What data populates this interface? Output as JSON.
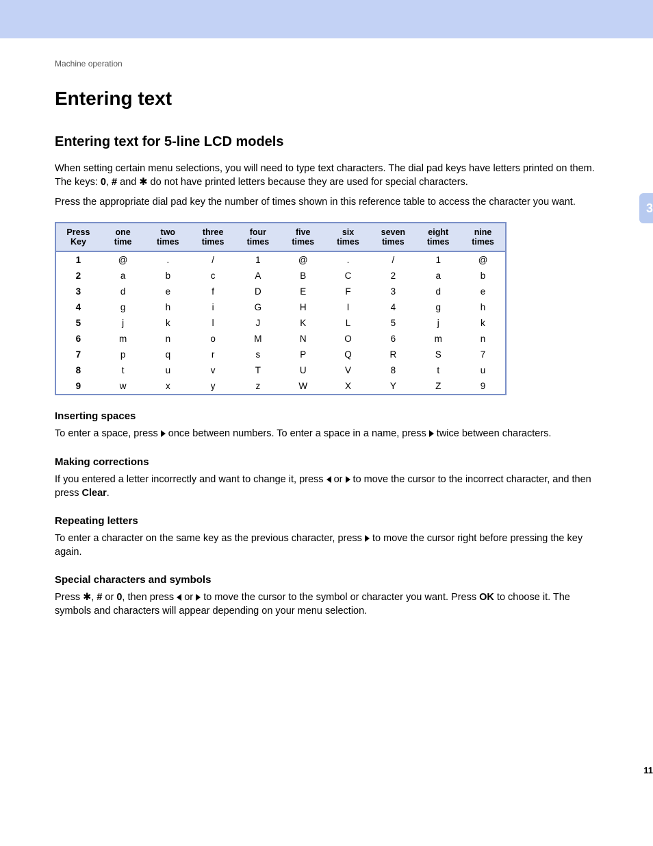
{
  "breadcrumb": "Machine operation",
  "h1": "Entering text",
  "h2": "Entering text for 5-line LCD models",
  "side_tab": "3",
  "page_number": "11",
  "intro": {
    "p1a": "When setting certain menu selections, you will need to type text characters. The dial pad keys have letters printed on them. The keys: ",
    "p1_key0": "0",
    "p1_comma": ", ",
    "p1_hash": "#",
    "p1_and": " and ",
    "p1_star": "✱",
    "p1b": " do not have printed letters because they are used for special characters.",
    "p2": "Press the appropriate dial pad key the number of times shown in this reference table to access the character you want."
  },
  "table": {
    "headers": [
      [
        "Press",
        "Key"
      ],
      [
        "one",
        "time"
      ],
      [
        "two",
        "times"
      ],
      [
        "three",
        "times"
      ],
      [
        "four",
        "times"
      ],
      [
        "five",
        "times"
      ],
      [
        "six",
        "times"
      ],
      [
        "seven",
        "times"
      ],
      [
        "eight",
        "times"
      ],
      [
        "nine",
        "times"
      ]
    ],
    "rows": [
      [
        "1",
        "@",
        ".",
        "/",
        "1",
        "@",
        ".",
        "/",
        "1",
        "@"
      ],
      [
        "2",
        "a",
        "b",
        "c",
        "A",
        "B",
        "C",
        "2",
        "a",
        "b"
      ],
      [
        "3",
        "d",
        "e",
        "f",
        "D",
        "E",
        "F",
        "3",
        "d",
        "e"
      ],
      [
        "4",
        "g",
        "h",
        "i",
        "G",
        "H",
        "I",
        "4",
        "g",
        "h"
      ],
      [
        "5",
        "j",
        "k",
        "l",
        "J",
        "K",
        "L",
        "5",
        "j",
        "k"
      ],
      [
        "6",
        "m",
        "n",
        "o",
        "M",
        "N",
        "O",
        "6",
        "m",
        "n"
      ],
      [
        "7",
        "p",
        "q",
        "r",
        "s",
        "P",
        "Q",
        "R",
        "S",
        "7"
      ],
      [
        "8",
        "t",
        "u",
        "v",
        "T",
        "U",
        "V",
        "8",
        "t",
        "u"
      ],
      [
        "9",
        "w",
        "x",
        "y",
        "z",
        "W",
        "X",
        "Y",
        "Z",
        "9"
      ]
    ]
  },
  "sections": {
    "spaces": {
      "h": "Inserting spaces",
      "t1": "To enter a space, press ",
      "t2": " once between numbers. To enter a space in a name, press ",
      "t3": " twice between characters."
    },
    "corrections": {
      "h": "Making corrections",
      "t1": "If you entered a letter incorrectly and want to change it, press ",
      "t_or": " or ",
      "t2": " to move the cursor to the incorrect character, and then press ",
      "clear": "Clear",
      "t3": "."
    },
    "repeating": {
      "h": "Repeating letters",
      "t1": "To enter a character on the same key as the previous character, press ",
      "t2": " to move the cursor right before pressing the key again."
    },
    "special": {
      "h": "Special characters and symbols",
      "t1": "Press ",
      "star": "✱",
      "comma1": ", ",
      "hash": "#",
      "or1": " or ",
      "zero": "0",
      "t2": ", then press ",
      "or2": " or ",
      "t3": " to move the cursor to the symbol or character you want. Press ",
      "ok": "OK",
      "t4": " to choose it. The symbols and characters will appear depending on your menu selection."
    }
  }
}
